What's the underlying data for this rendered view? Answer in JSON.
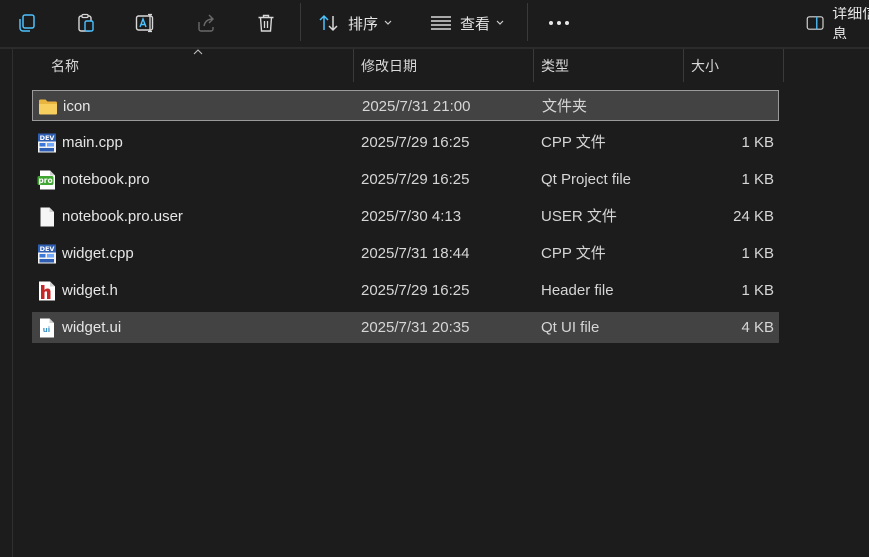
{
  "toolbar": {
    "sort_label": "排序",
    "view_label": "查看",
    "more_label": "···",
    "details_label": "详细信息"
  },
  "columns": {
    "name": "名称",
    "modified": "修改日期",
    "type": "类型",
    "size": "大小"
  },
  "files": [
    {
      "name": "icon",
      "date": "2025/7/31 21:00",
      "type": "文件夹",
      "size": "",
      "icon": "folder-icon"
    },
    {
      "name": "main.cpp",
      "date": "2025/7/29 16:25",
      "type": "CPP 文件",
      "size": "1 KB",
      "icon": "cpp-file-icon"
    },
    {
      "name": "notebook.pro",
      "date": "2025/7/29 16:25",
      "type": "Qt Project file",
      "size": "1 KB",
      "icon": "qt-pro-file-icon"
    },
    {
      "name": "notebook.pro.user",
      "date": "2025/7/30 4:13",
      "type": "USER 文件",
      "size": "24 KB",
      "icon": "blank-file-icon"
    },
    {
      "name": "widget.cpp",
      "date": "2025/7/31 18:44",
      "type": "CPP 文件",
      "size": "1 KB",
      "icon": "cpp-file-icon"
    },
    {
      "name": "widget.h",
      "date": "2025/7/29 16:25",
      "type": "Header file",
      "size": "1 KB",
      "icon": "header-file-icon"
    },
    {
      "name": "widget.ui",
      "date": "2025/7/31 20:35",
      "type": "Qt UI file",
      "size": "4 KB",
      "icon": "qt-ui-file-icon"
    }
  ],
  "colors": {
    "background": "#1c1c1c",
    "selection": "#434343",
    "accent": "#4cc2ff"
  }
}
